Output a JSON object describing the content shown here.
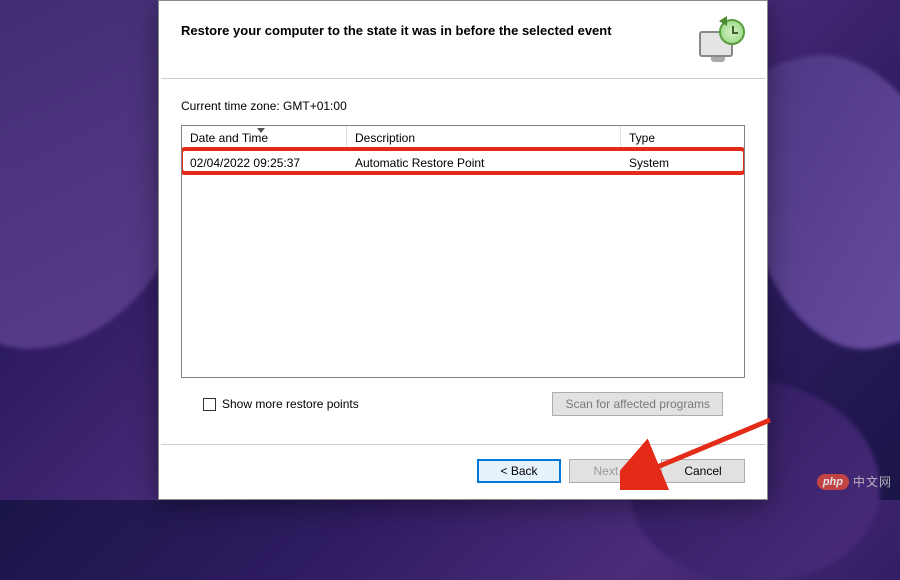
{
  "header": {
    "title": "Restore your computer to the state it was in before the selected event"
  },
  "timezone_label": "Current time zone: GMT+01:00",
  "table": {
    "columns": {
      "datetime": "Date and Time",
      "description": "Description",
      "type": "Type"
    },
    "rows": [
      {
        "datetime": "02/04/2022 09:25:37",
        "description": "Automatic Restore Point",
        "type": "System"
      }
    ]
  },
  "footer": {
    "show_more_label": "Show more restore points",
    "scan_button": "Scan for affected programs"
  },
  "buttons": {
    "back": "< Back",
    "next": "Next >",
    "cancel": "Cancel"
  },
  "watermark": {
    "badge": "php",
    "text": "中文网"
  }
}
